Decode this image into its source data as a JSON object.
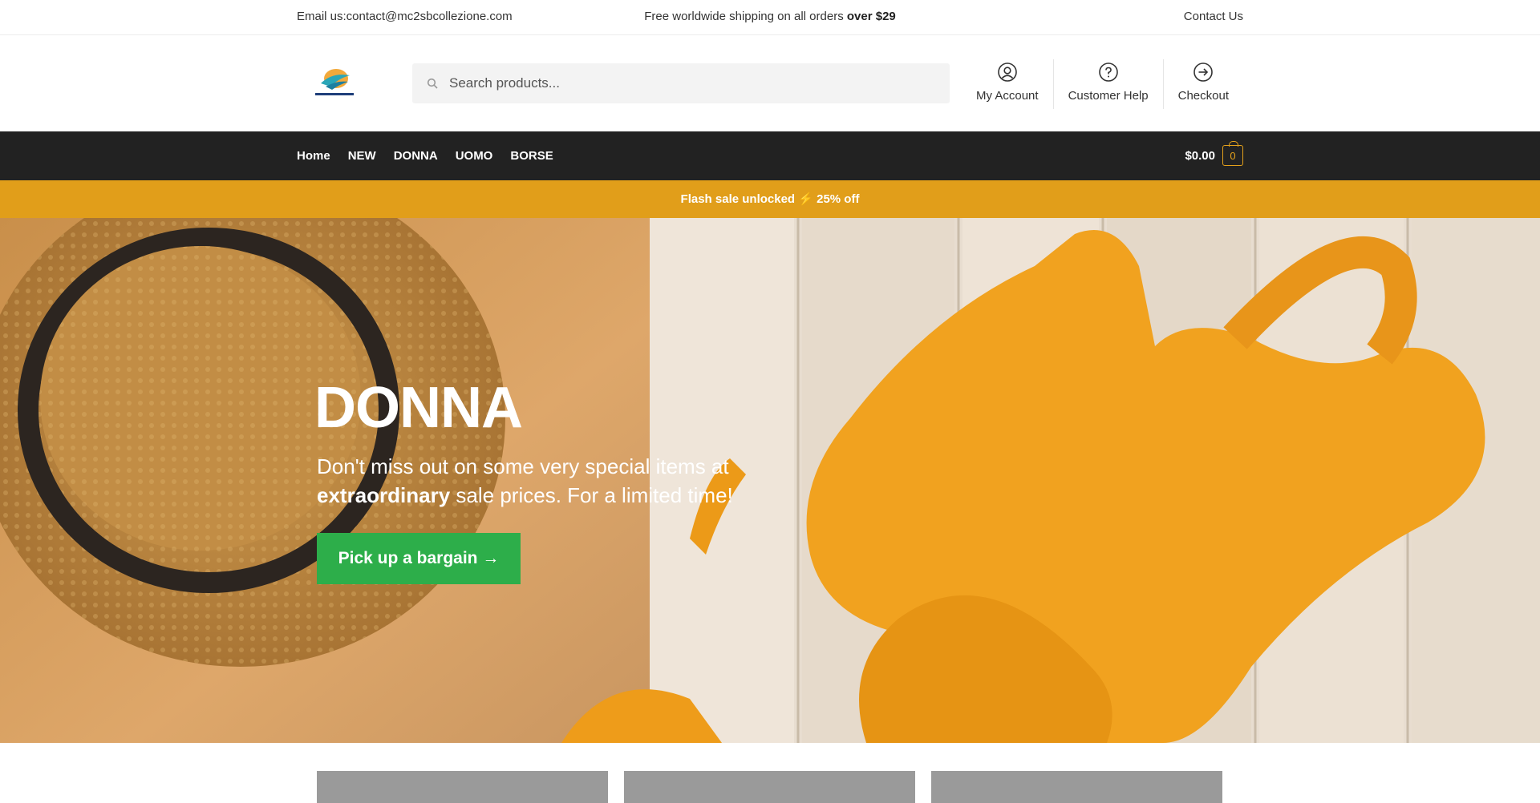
{
  "topbar": {
    "email": "Email us:contact@mc2sbcollezione.com",
    "shipping_prefix": "Free worldwide shipping on all orders",
    "shipping_bold": "over $29",
    "contact": "Contact Us"
  },
  "header": {
    "search_placeholder": "Search products...",
    "icons": [
      {
        "label": "My Account",
        "icon": "user-circle-icon"
      },
      {
        "label": "Customer Help",
        "icon": "help-circle-icon"
      },
      {
        "label": "Checkout",
        "icon": "arrow-circle-right-icon"
      }
    ]
  },
  "nav": {
    "items": [
      "Home",
      "NEW",
      "DONNA",
      "UOMO",
      "BORSE"
    ],
    "cart_amount": "$0.00",
    "cart_count": "0"
  },
  "flash": "Flash sale unlocked ⚡ 25% off",
  "hero": {
    "title": "DONNA",
    "sub_line1": "Don't miss out on some very special items at",
    "sub_bold": "extraordinary",
    "sub_rest": "sale prices. For a limited time!",
    "cta": "Pick up a bargain →"
  },
  "colors": {
    "nav_bg": "#222222",
    "flash_bg": "#e19e1a",
    "cta_bg": "#2dae4a"
  }
}
